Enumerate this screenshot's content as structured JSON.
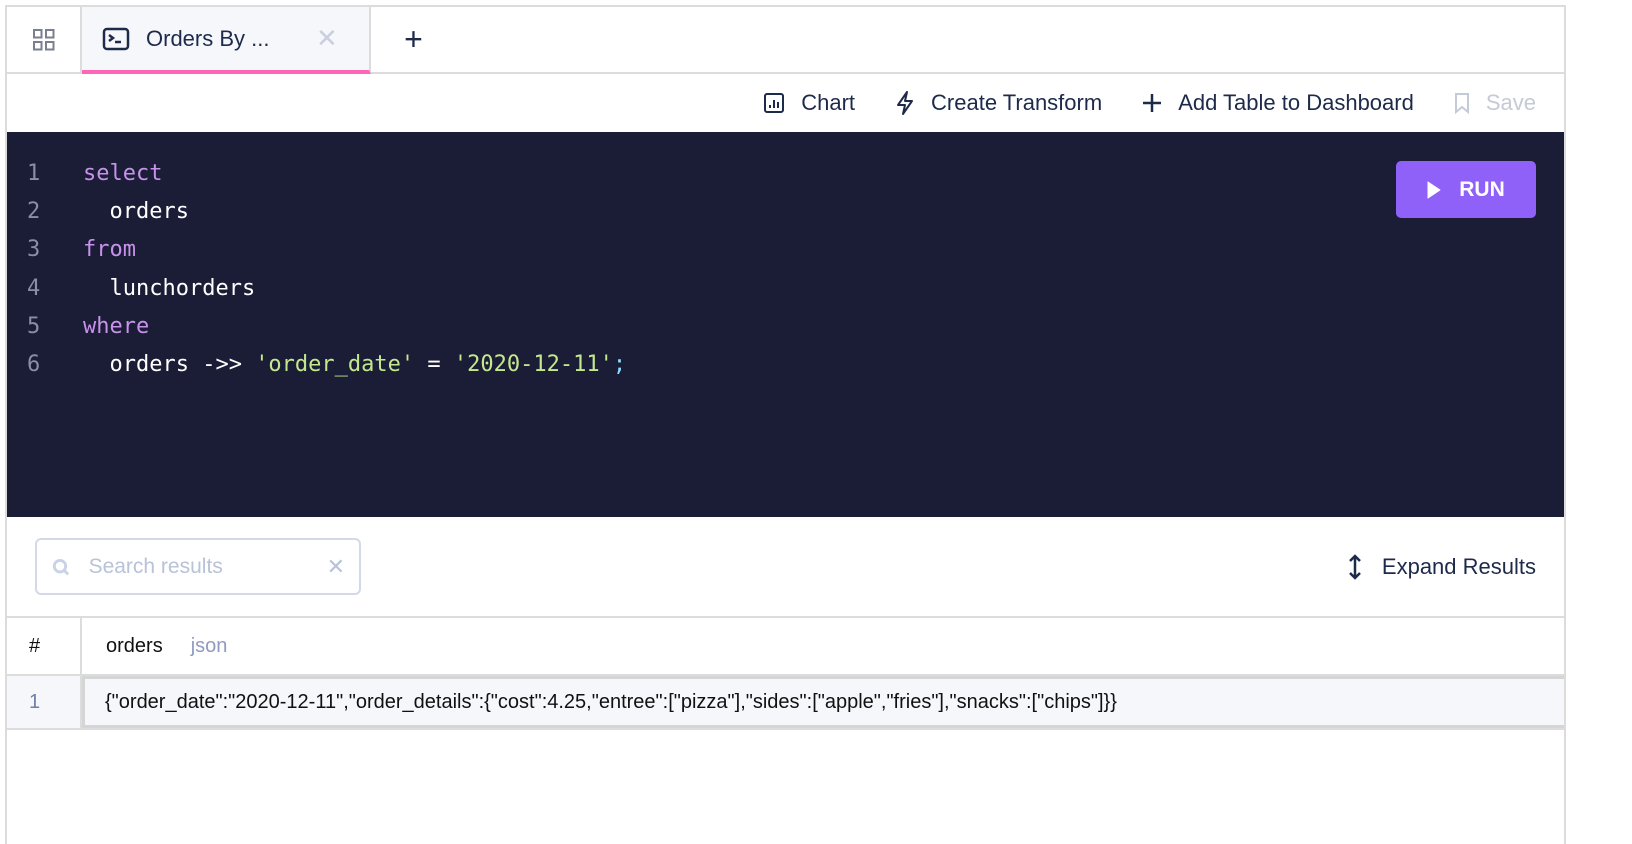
{
  "tabs": {
    "active_title": "Orders By ...",
    "new_tab": "+"
  },
  "toolbar": {
    "chart": "Chart",
    "create_transform": "Create Transform",
    "add_table": "Add Table to Dashboard",
    "save": "Save"
  },
  "editor": {
    "run_label": "RUN",
    "lines": [
      {
        "num": "1",
        "parts": [
          {
            "t": "select",
            "c": "kw"
          }
        ]
      },
      {
        "num": "2",
        "parts": [
          {
            "t": "  orders",
            "c": ""
          }
        ]
      },
      {
        "num": "3",
        "parts": [
          {
            "t": "from",
            "c": "kw"
          }
        ]
      },
      {
        "num": "4",
        "parts": [
          {
            "t": "  lunchorders",
            "c": ""
          }
        ]
      },
      {
        "num": "5",
        "parts": [
          {
            "t": "where",
            "c": "kw"
          }
        ]
      },
      {
        "num": "6",
        "parts": [
          {
            "t": "  orders ->> ",
            "c": ""
          },
          {
            "t": "'order_date'",
            "c": "str"
          },
          {
            "t": " = ",
            "c": ""
          },
          {
            "t": "'2020-12-11'",
            "c": "str"
          },
          {
            "t": ";",
            "c": "punc"
          }
        ]
      }
    ]
  },
  "results": {
    "search_placeholder": "Search results",
    "expand_label": "Expand Results",
    "columns": {
      "num_header": "#",
      "name": "orders",
      "type": "json"
    },
    "rows": [
      {
        "num": "1",
        "value": "{\"order_date\":\"2020-12-11\",\"order_details\":{\"cost\":4.25,\"entree\":[\"pizza\"],\"sides\":[\"apple\",\"fries\"],\"snacks\":[\"chips\"]}}"
      }
    ]
  }
}
